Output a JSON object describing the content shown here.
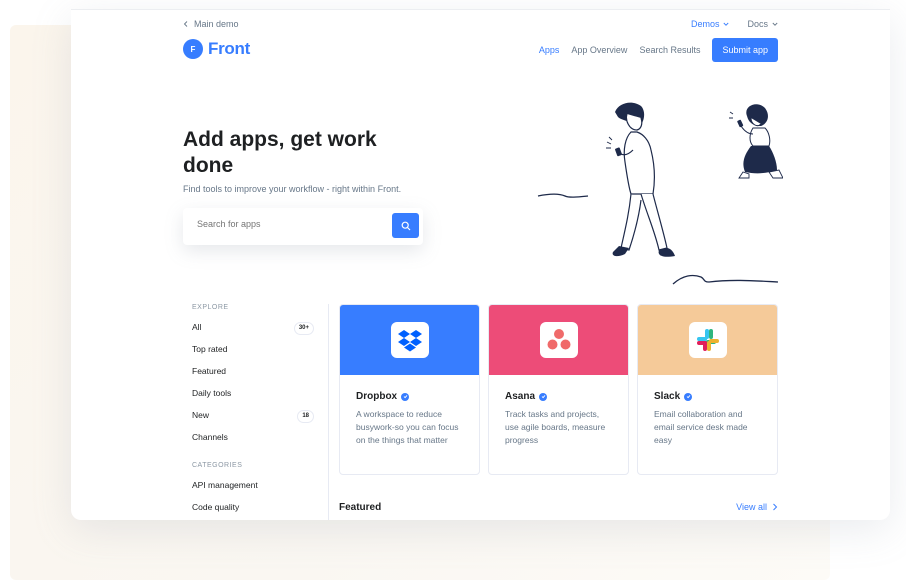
{
  "topbar": {
    "back_link": "Main demo",
    "demos": "Demos",
    "docs": "Docs"
  },
  "header": {
    "logo_text": "Front",
    "logo_mark": "F",
    "nav": [
      "Apps",
      "App Overview",
      "Search Results"
    ],
    "submit_label": "Submit app"
  },
  "hero": {
    "title": "Add apps, get work done",
    "subtitle": "Find tools to improve your workflow - right within Front.",
    "search_placeholder": "Search for apps"
  },
  "sidebar": {
    "explore_heading": "EXPLORE",
    "explore_items": [
      {
        "label": "All",
        "badge": "30+"
      },
      {
        "label": "Top rated",
        "badge": ""
      },
      {
        "label": "Featured",
        "badge": ""
      },
      {
        "label": "Daily tools",
        "badge": ""
      },
      {
        "label": "New",
        "badge": "18"
      },
      {
        "label": "Channels",
        "badge": ""
      }
    ],
    "categories_heading": "CATEGORIES",
    "category_items": [
      "API management",
      "Code quality"
    ]
  },
  "cards": [
    {
      "name": "Dropbox",
      "desc": "A workspace to reduce busywork-so you can focus on the things that matter",
      "color": "#377dff"
    },
    {
      "name": "Asana",
      "desc": "Track tasks and projects, use agile boards, measure progress",
      "color": "#ed4c78"
    },
    {
      "name": "Slack",
      "desc": "Email collaboration and email service desk made easy",
      "color": "#f5ca99"
    }
  ],
  "featured": {
    "label": "Featured",
    "view_all": "View all"
  },
  "colors": {
    "primary": "#377dff",
    "text": "#1e2022",
    "muted": "#677788"
  }
}
